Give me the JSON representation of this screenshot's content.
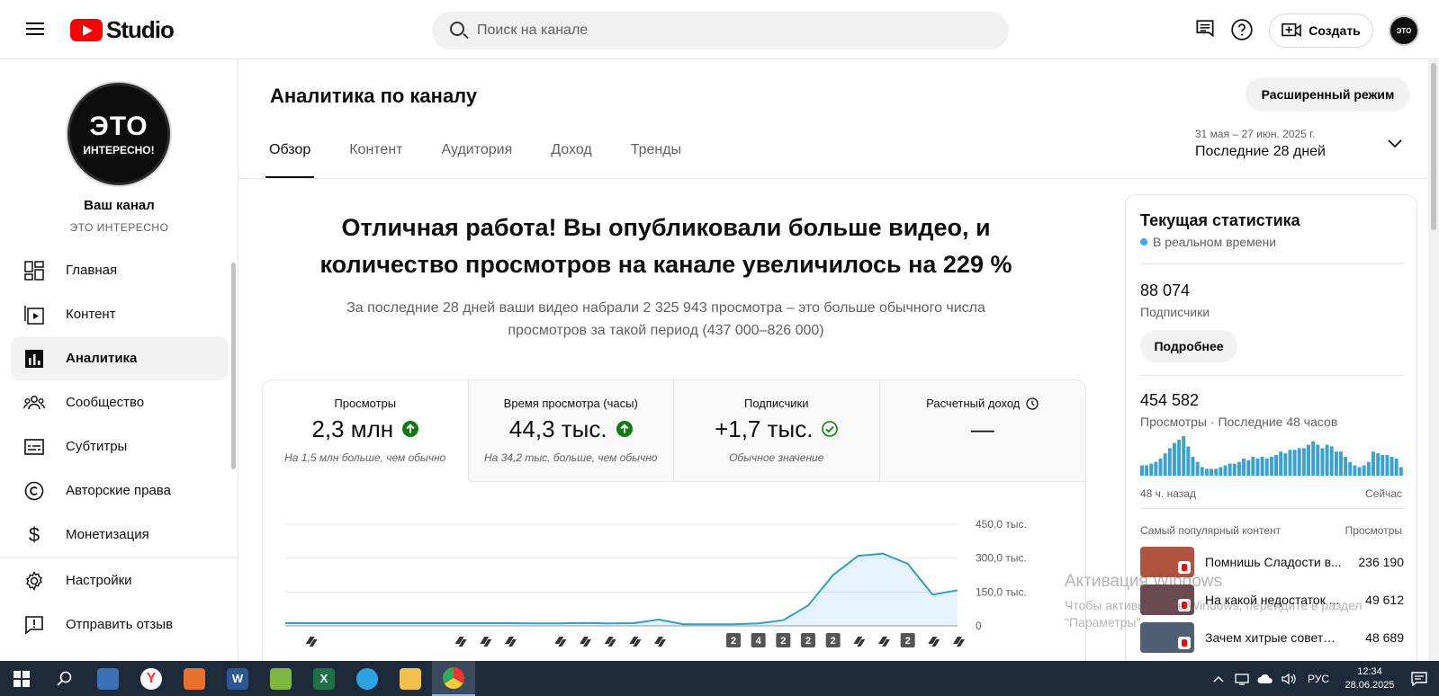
{
  "app": {
    "logo_text": "Studio"
  },
  "search": {
    "placeholder": "Поиск на канале"
  },
  "header": {
    "create_label": "Создать",
    "avatar_text": "ЭТО"
  },
  "channel": {
    "avatar_big": "ЭТО",
    "avatar_small": "ИНТЕРЕСНО!",
    "label": "Ваш канал",
    "name": "ЭТО ИНТЕРЕСНО"
  },
  "sidebar": {
    "items": [
      {
        "label": "Главная",
        "icon": "dashboard-icon"
      },
      {
        "label": "Контент",
        "icon": "content-icon"
      },
      {
        "label": "Аналитика",
        "icon": "analytics-icon",
        "active": true
      },
      {
        "label": "Сообщество",
        "icon": "community-icon"
      },
      {
        "label": "Субтитры",
        "icon": "subtitles-icon"
      },
      {
        "label": "Авторские права",
        "icon": "copyright-icon"
      },
      {
        "label": "Монетизация",
        "icon": "monetization-icon"
      }
    ],
    "bottom_items": [
      {
        "label": "Настройки",
        "icon": "settings-icon"
      },
      {
        "label": "Отправить отзыв",
        "icon": "feedback-icon"
      }
    ]
  },
  "page": {
    "title": "Аналитика по каналу",
    "advanced_label": "Расширенный режим",
    "tabs": [
      "Обзор",
      "Контент",
      "Аудитория",
      "Доход",
      "Тренды"
    ],
    "date_range": "31 мая – 27 июн. 2025 г.",
    "date_period": "Последние 28 дней"
  },
  "headline": {
    "line1": "Отличная работа! Вы опубликовали больше видео, и",
    "line2": "количество просмотров на канале увеличилось на 229 %",
    "sub1": "За последние 28 дней ваши видео набрали 2 325 943 просмотра – это больше обычного числа",
    "sub2": "просмотров за такой период (437 000–826 000)"
  },
  "metrics": [
    {
      "title": "Просмотры",
      "value": "2,3 млн",
      "note": "На 1,5 млн больше, чем обычно",
      "indicator": "arrow-up",
      "active": true
    },
    {
      "title": "Время просмотра (часы)",
      "value": "44,3 тыс.",
      "note": "На 34,2 тыс. больше, чем обычно",
      "indicator": "arrow-up"
    },
    {
      "title": "Подписчики",
      "value": "+1,7 тыс.",
      "note": "Обычное значение",
      "indicator": "check"
    },
    {
      "title": "Расчетный доход",
      "value": "—",
      "note": "",
      "indicator": "clock"
    }
  ],
  "chart_data": {
    "type": "area",
    "x": [
      1,
      2,
      3,
      4,
      5,
      6,
      7,
      8,
      9,
      10,
      11,
      12,
      13,
      14,
      15,
      16,
      17,
      18,
      19,
      20,
      21,
      22,
      23,
      24,
      25,
      26,
      27,
      28
    ],
    "values": [
      12000,
      12000,
      12000,
      12000,
      12000,
      12000,
      12000,
      12000,
      12000,
      12000,
      11000,
      11000,
      13000,
      11000,
      12000,
      28000,
      7000,
      7000,
      7000,
      11000,
      25000,
      90000,
      225000,
      310000,
      320000,
      275000,
      138000,
      158000
    ],
    "ylim": [
      0,
      450000
    ],
    "yticks": [
      "0",
      "150,0 тыс.",
      "300,0 тыс.",
      "450,0 тыс."
    ],
    "ytick_values": [
      0,
      150000,
      300000,
      450000
    ],
    "markers": [
      {
        "day": 2,
        "label": ""
      },
      {
        "day": 8,
        "label": ""
      },
      {
        "day": 9,
        "label": ""
      },
      {
        "day": 10,
        "label": ""
      },
      {
        "day": 12,
        "label": ""
      },
      {
        "day": 13,
        "label": ""
      },
      {
        "day": 14,
        "label": ""
      },
      {
        "day": 15,
        "label": ""
      },
      {
        "day": 16,
        "label": ""
      },
      {
        "day": 19,
        "label": "2"
      },
      {
        "day": 20,
        "label": "4"
      },
      {
        "day": 21,
        "label": "2"
      },
      {
        "day": 22,
        "label": "2"
      },
      {
        "day": 23,
        "label": "2"
      },
      {
        "day": 24,
        "label": ""
      },
      {
        "day": 25,
        "label": ""
      },
      {
        "day": 26,
        "label": "2"
      },
      {
        "day": 27,
        "label": ""
      },
      {
        "day": 28,
        "label": ""
      }
    ],
    "grid": true,
    "color": "#3ea6ff"
  },
  "realtime": {
    "title": "Текущая статистика",
    "sub": "В реальном времени",
    "subscribers_value": "88 074",
    "subscribers_label": "Подписчики",
    "more_label": "Подробнее",
    "views_value": "454 582",
    "views_label": "Просмотры · Последние 48 часов",
    "axis_left": "48 ч. назад",
    "axis_right": "Сейчас",
    "bars": [
      6,
      6,
      7,
      8,
      10,
      13,
      16,
      19,
      21,
      23,
      17,
      11,
      8,
      5,
      4,
      4,
      4,
      5,
      6,
      7,
      7,
      8,
      10,
      9,
      11,
      10,
      11,
      10,
      11,
      12,
      14,
      13,
      15,
      15,
      16,
      16,
      18,
      20,
      18,
      16,
      18,
      17,
      14,
      14,
      11,
      8,
      6,
      5,
      6,
      8,
      14,
      13,
      12,
      12,
      11,
      10,
      5
    ],
    "top_label": "Самый популярный контент",
    "top_col": "Просмотры",
    "top_items": [
      {
        "title": "Помнишь Сладости в...",
        "views": "236 190",
        "thumb": "#b0533f"
      },
      {
        "title": "На какой недостаток ...",
        "views": "49 612",
        "thumb": "#6b4a4f"
      },
      {
        "title": "Зачем хитрые советск...",
        "views": "48 689",
        "thumb": "#4f5f74"
      }
    ]
  },
  "watermark": {
    "title": "Активация Windows",
    "sub": "Чтобы активировать Windows, перейдите в раздел \"Параметры\"."
  },
  "taskbar": {
    "lang": "РУС",
    "time": "12:34",
    "date": "28.06.2025"
  }
}
